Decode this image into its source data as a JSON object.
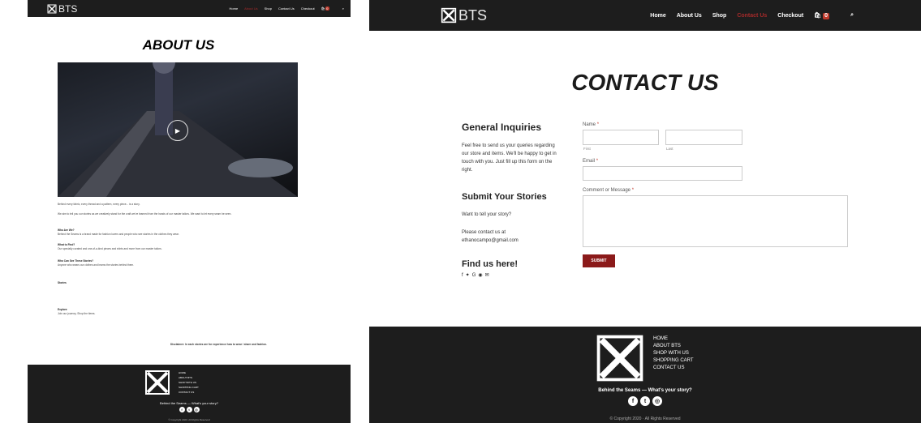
{
  "left": {
    "brand": "BTS",
    "nav": [
      "Home",
      "About Us",
      "Shop",
      "Contact Us",
      "Checkout"
    ],
    "cart_count": "0",
    "title": "ABOUT US",
    "paragraphs": [
      "Behind every fabric, every thread and a pattern, every piece... is a story.",
      "We aim to tell you our stories as we creatively stand for the craft we've learned from the hands of our master tailors. We want to let every seam be seen.",
      "Who Are We?",
      "Behind the Seams is a brand made for fashion lovers and people who see stories in the clothes they wear.",
      "What to Find?",
      "Our specially curated and one-of-a-kind pieces and shirts and more from our master tailors.",
      "Who Can See These Stories?",
      "Anyone who wears our clothes and learns the stories behind them.",
      "Stories",
      "Explore",
      "Join our journey, Shop the items."
    ],
    "quote": "Disclaimer: In each stories are for experience how to wear / share and fashion.",
    "footer": {
      "links": [
        "HOME",
        "ABOUT BTS",
        "SHOP WITH US",
        "SHOPPING CART",
        "CONTACT US"
      ],
      "tagline": "Behind the Seams — What's your story?",
      "copyright": "© Copyright 2020. All Rights Reserved"
    }
  },
  "right": {
    "brand": "BTS",
    "nav": [
      "Home",
      "About Us",
      "Shop",
      "Contact Us",
      "Checkout"
    ],
    "cart_count": "0",
    "title": "CONTACT US",
    "general": {
      "heading": "General Inquiries",
      "text": "Feel free to send us your queries regarding our store and items. We'll be happy to get in touch with you. Just fill up this form on the right."
    },
    "stories": {
      "heading": "Submit Your Stories",
      "question": "Want to tell your story?",
      "contact": "Please contact us at",
      "email": "ethanocampo@gmail.com"
    },
    "find": {
      "heading": "Find us here!"
    },
    "form": {
      "name_label": "Name",
      "first_sub": "First",
      "last_sub": "Last",
      "email_label": "Email",
      "message_label": "Comment or Message",
      "required_mark": "*",
      "submit": "SUBMIT"
    },
    "footer": {
      "links": [
        "HOME",
        "ABOUT BTS",
        "SHOP WITH US",
        "SHOPPING CART",
        "CONTACT US"
      ],
      "tagline": "Behind the Seams — What's your story?",
      "copyright": "© Copyright 2020 · All Rights Reserved"
    }
  },
  "colors": {
    "nav_bg": "#1d1d1d",
    "accent": "#8b1a1a",
    "active_link": "#a52a2a"
  }
}
